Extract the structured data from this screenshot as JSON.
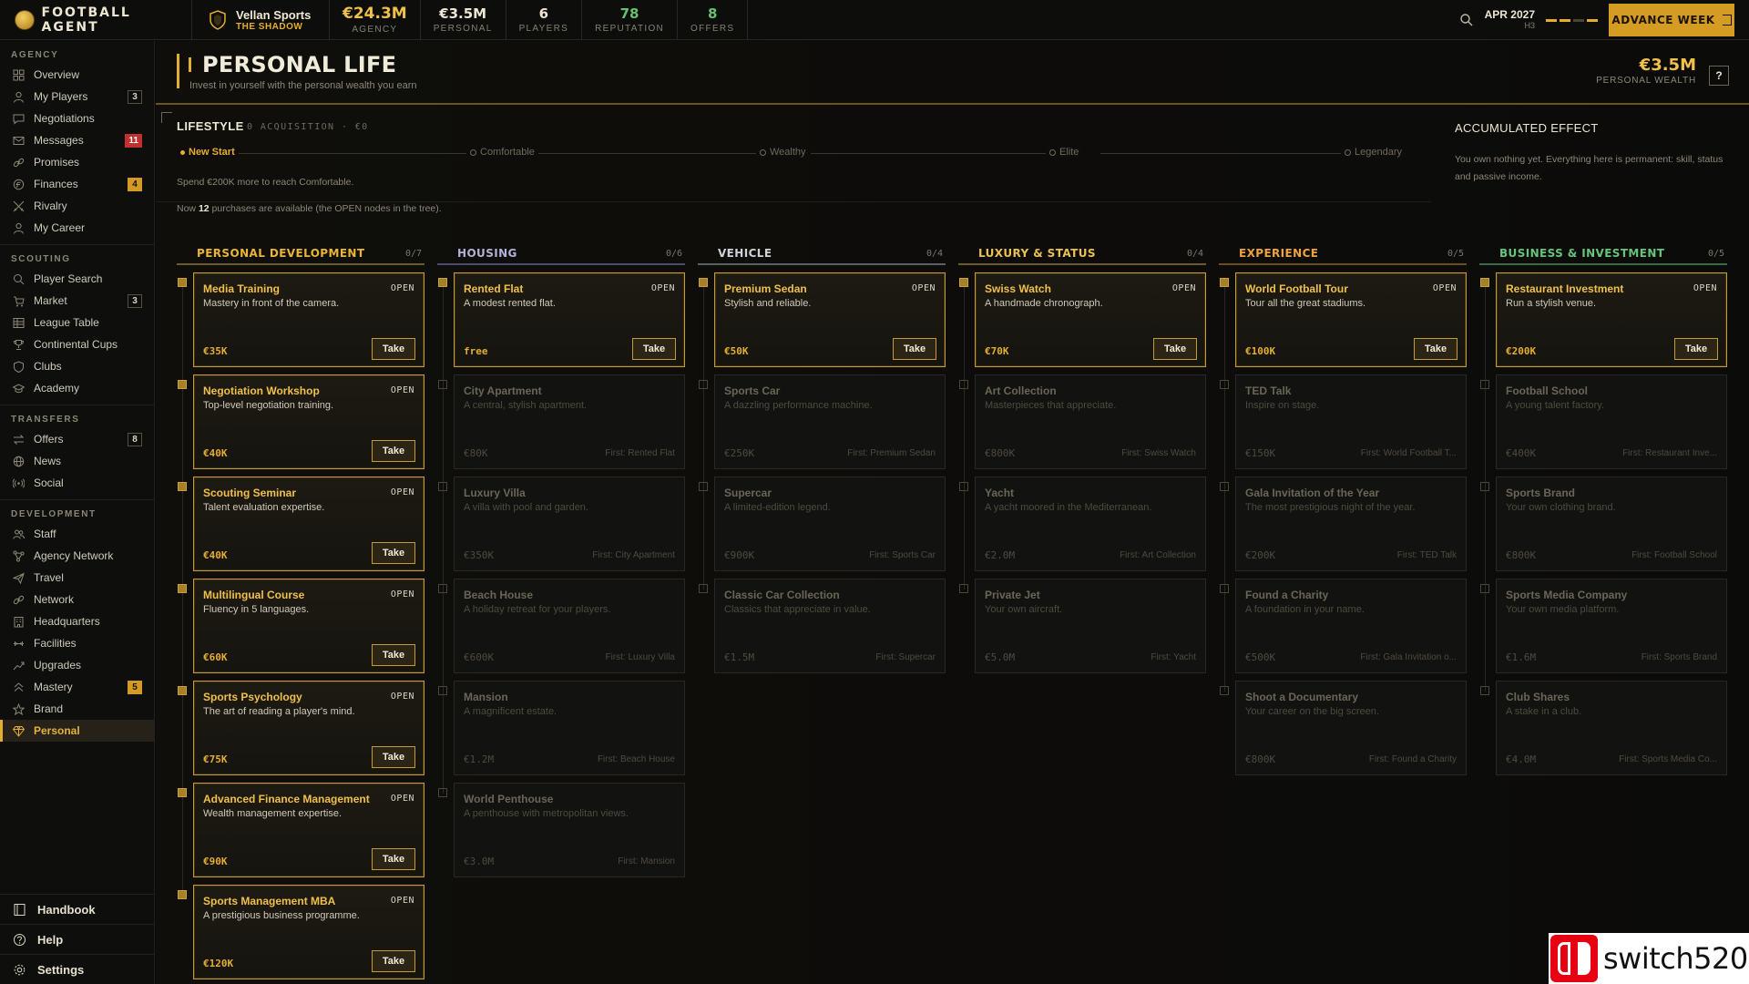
{
  "app": {
    "title": "FOOTBALL AGENT"
  },
  "agency": {
    "name": "Vellan Sports",
    "tagline": "THE SHADOW"
  },
  "stats": [
    {
      "value": "€24.3M",
      "label": "AGENCY",
      "style": "gold"
    },
    {
      "value": "€3.5M",
      "label": "PERSONAL",
      "style": ""
    },
    {
      "value": "6",
      "label": "PLAYERS",
      "style": ""
    },
    {
      "value": "78",
      "label": "REPUTATION",
      "style": "green"
    },
    {
      "value": "8",
      "label": "OFFERS",
      "style": "green"
    }
  ],
  "date": {
    "main": "APR 2027",
    "sub": "H3"
  },
  "week_progress": [
    true,
    true,
    false,
    true
  ],
  "advance_label": "ADVANCE WEEK",
  "sidebar": {
    "sections": [
      {
        "title": "AGENCY",
        "items": [
          {
            "label": "Overview",
            "icon": "grid-icon",
            "badge": ""
          },
          {
            "label": "My Players",
            "icon": "user-icon",
            "badge": "3"
          },
          {
            "label": "Negotiations",
            "icon": "chat-icon",
            "badge": ""
          },
          {
            "label": "Messages",
            "icon": "mail-icon",
            "badge": "11",
            "badge_style": "red"
          },
          {
            "label": "Promises",
            "icon": "link-icon",
            "badge": ""
          },
          {
            "label": "Finances",
            "icon": "coin-icon",
            "badge": "4",
            "badge_style": "gold"
          },
          {
            "label": "Rivalry",
            "icon": "swords-icon",
            "badge": ""
          },
          {
            "label": "My Career",
            "icon": "person-icon",
            "badge": ""
          }
        ]
      },
      {
        "title": "SCOUTING",
        "items": [
          {
            "label": "Player Search",
            "icon": "search-icon",
            "badge": ""
          },
          {
            "label": "Market",
            "icon": "cart-icon",
            "badge": "3"
          },
          {
            "label": "League Table",
            "icon": "table-icon",
            "badge": ""
          },
          {
            "label": "Continental Cups",
            "icon": "trophy-icon",
            "badge": ""
          },
          {
            "label": "Clubs",
            "icon": "shield-icon",
            "badge": ""
          },
          {
            "label": "Academy",
            "icon": "cap-icon",
            "badge": ""
          }
        ]
      },
      {
        "title": "TRANSFERS",
        "items": [
          {
            "label": "Offers",
            "icon": "arrows-icon",
            "badge": "8"
          },
          {
            "label": "News",
            "icon": "globe-icon",
            "badge": ""
          },
          {
            "label": "Social",
            "icon": "broadcast-icon",
            "badge": ""
          }
        ]
      },
      {
        "title": "DEVELOPMENT",
        "items": [
          {
            "label": "Staff",
            "icon": "team-icon",
            "badge": ""
          },
          {
            "label": "Agency Network",
            "icon": "network-icon",
            "badge": ""
          },
          {
            "label": "Travel",
            "icon": "plane-icon",
            "badge": ""
          },
          {
            "label": "Network",
            "icon": "link-icon",
            "badge": ""
          },
          {
            "label": "Headquarters",
            "icon": "building-icon",
            "badge": ""
          },
          {
            "label": "Facilities",
            "icon": "dumbbell-icon",
            "badge": ""
          },
          {
            "label": "Upgrades",
            "icon": "trend-icon",
            "badge": ""
          },
          {
            "label": "Mastery",
            "icon": "chevrons-icon",
            "badge": "5",
            "badge_style": "gold"
          },
          {
            "label": "Brand",
            "icon": "star-icon",
            "badge": ""
          },
          {
            "label": "Personal",
            "icon": "diamond-icon",
            "badge": "",
            "active": true
          }
        ]
      }
    ],
    "bottom": [
      {
        "label": "Handbook",
        "icon": "book-icon"
      },
      {
        "label": "Help",
        "icon": "help-icon"
      },
      {
        "label": "Settings",
        "icon": "gear-icon"
      }
    ]
  },
  "page": {
    "title": "PERSONAL LIFE",
    "subtitle": "Invest in yourself with the personal wealth you earn",
    "wealth_value": "€3.5M",
    "wealth_label": "PERSONAL WEALTH",
    "help_label": "?"
  },
  "lifestyle": {
    "title": "LIFESTYLE",
    "subtitle": "0 ACQUISITION · €0",
    "stages": [
      "New Start",
      "Comfortable",
      "Wealthy",
      "Elite",
      "Legendary"
    ],
    "current_stage": 0,
    "hint": "Spend €200K more to reach Comfortable.",
    "available_pre": "Now ",
    "available_count": "12",
    "available_post": " purchases are available (the OPEN nodes in the tree)."
  },
  "accumulated": {
    "title": "ACCUMULATED EFFECT",
    "desc": "You own nothing yet. Everything here is permanent: skill, status and passive income."
  },
  "take_label": "Take",
  "open_label": "OPEN",
  "columns": [
    {
      "name": "PERSONAL DEVELOPMENT",
      "count": "0/7",
      "nodes": [
        {
          "title": "Media Training",
          "desc": "Mastery in front of the camera.",
          "price": "€35K",
          "open": true
        },
        {
          "title": "Negotiation Workshop",
          "desc": "Top-level negotiation training.",
          "price": "€40K",
          "open": true
        },
        {
          "title": "Scouting Seminar",
          "desc": "Talent evaluation expertise.",
          "price": "€40K",
          "open": true
        },
        {
          "title": "Multilingual Course",
          "desc": "Fluency in 5 languages.",
          "price": "€60K",
          "open": true
        },
        {
          "title": "Sports Psychology",
          "desc": "The art of reading a player's mind.",
          "price": "€75K",
          "open": true
        },
        {
          "title": "Advanced Finance Management",
          "desc": "Wealth management expertise.",
          "price": "€90K",
          "open": true
        },
        {
          "title": "Sports Management MBA",
          "desc": "A prestigious business programme.",
          "price": "€120K",
          "open": true
        }
      ]
    },
    {
      "name": "HOUSING",
      "count": "0/6",
      "nodes": [
        {
          "title": "Rented Flat",
          "desc": "A modest rented flat.",
          "price": "free",
          "open": true
        },
        {
          "title": "City Apartment",
          "desc": "A central, stylish apartment.",
          "price": "€80K",
          "req": "First: Rented Flat"
        },
        {
          "title": "Luxury Villa",
          "desc": "A villa with pool and garden.",
          "price": "€350K",
          "req": "First: City Apartment"
        },
        {
          "title": "Beach House",
          "desc": "A holiday retreat for your players.",
          "price": "€600K",
          "req": "First: Luxury Villa"
        },
        {
          "title": "Mansion",
          "desc": "A magnificent estate.",
          "price": "€1.2M",
          "req": "First: Beach House"
        },
        {
          "title": "World Penthouse",
          "desc": "A penthouse with metropolitan views.",
          "price": "€3.0M",
          "req": "First: Mansion"
        }
      ]
    },
    {
      "name": "VEHICLE",
      "count": "0/4",
      "nodes": [
        {
          "title": "Premium Sedan",
          "desc": "Stylish and reliable.",
          "price": "€50K",
          "open": true
        },
        {
          "title": "Sports Car",
          "desc": "A dazzling performance machine.",
          "price": "€250K",
          "req": "First: Premium Sedan"
        },
        {
          "title": "Supercar",
          "desc": "A limited-edition legend.",
          "price": "€900K",
          "req": "First: Sports Car"
        },
        {
          "title": "Classic Car Collection",
          "desc": "Classics that appreciate in value.",
          "price": "€1.5M",
          "req": "First: Supercar"
        }
      ]
    },
    {
      "name": "LUXURY & STATUS",
      "count": "0/4",
      "nodes": [
        {
          "title": "Swiss Watch",
          "desc": "A handmade chronograph.",
          "price": "€70K",
          "open": true
        },
        {
          "title": "Art Collection",
          "desc": "Masterpieces that appreciate.",
          "price": "€800K",
          "req": "First: Swiss Watch"
        },
        {
          "title": "Yacht",
          "desc": "A yacht moored in the Mediterranean.",
          "price": "€2.0M",
          "req": "First: Art Collection"
        },
        {
          "title": "Private Jet",
          "desc": "Your own aircraft.",
          "price": "€5.0M",
          "req": "First: Yacht"
        }
      ]
    },
    {
      "name": "EXPERIENCE",
      "count": "0/5",
      "nodes": [
        {
          "title": "World Football Tour",
          "desc": "Tour all the great stadiums.",
          "price": "€100K",
          "open": true
        },
        {
          "title": "TED Talk",
          "desc": "Inspire on stage.",
          "price": "€150K",
          "req": "First: World Football T..."
        },
        {
          "title": "Gala Invitation of the Year",
          "desc": "The most prestigious night of the year.",
          "price": "€200K",
          "req": "First: TED Talk"
        },
        {
          "title": "Found a Charity",
          "desc": "A foundation in your name.",
          "price": "€500K",
          "req": "First: Gala Invitation o..."
        },
        {
          "title": "Shoot a Documentary",
          "desc": "Your career on the big screen.",
          "price": "€800K",
          "req": "First: Found a Charity"
        }
      ]
    },
    {
      "name": "BUSINESS & INVESTMENT",
      "count": "0/5",
      "nodes": [
        {
          "title": "Restaurant Investment",
          "desc": "Run a stylish venue.",
          "price": "€200K",
          "open": true
        },
        {
          "title": "Football School",
          "desc": "A young talent factory.",
          "price": "€400K",
          "req": "First: Restaurant Inve..."
        },
        {
          "title": "Sports Brand",
          "desc": "Your own clothing brand.",
          "price": "€800K",
          "req": "First: Football School"
        },
        {
          "title": "Sports Media Company",
          "desc": "Your own media platform.",
          "price": "€1.6M",
          "req": "First: Sports Brand"
        },
        {
          "title": "Club Shares",
          "desc": "A stake in a club.",
          "price": "€4.0M",
          "req": "First: Sports Media Co..."
        }
      ]
    }
  ],
  "watermark": {
    "text": "switch520"
  },
  "colors": {
    "accent": "#e4ae2e",
    "background": "#0b0b09",
    "danger": "#c12f2f",
    "positive": "#65c16e"
  }
}
